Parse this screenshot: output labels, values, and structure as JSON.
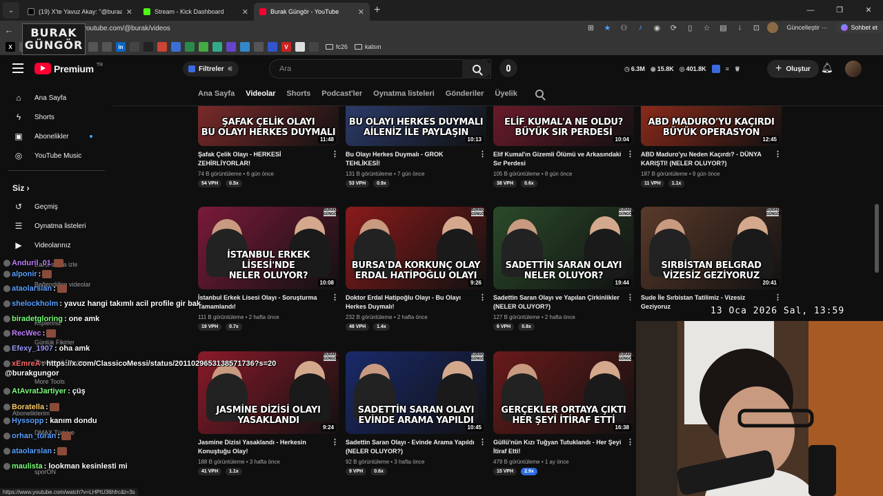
{
  "browser": {
    "tabs": [
      {
        "title": "(19) X'te Yavuz Akay: \"@buraakgu",
        "close": "✕",
        "fav": "#000000",
        "fav_border": "#888888"
      },
      {
        "title": "Stream - Kick Dashboard",
        "close": "✕",
        "fav": "#53fc18",
        "fav_border": "#53fc18"
      },
      {
        "title": "Burak Güngör - YouTube",
        "close": "✕",
        "fav": "#ff0033",
        "fav_border": "#ff0033"
      }
    ],
    "url": "youtube.com/@burak/videos",
    "update_label": "Güncelleştir",
    "chat_label": "Sohbet et",
    "folders": [
      "fc26",
      "kalsın"
    ],
    "status_url": "https://www.youtube.com/watch?v=LHPtU36hfrc&t=3s",
    "overlay_logo": [
      "BURAK",
      "GÜNGÖR"
    ]
  },
  "masthead": {
    "brand": "Premium",
    "region": "TR",
    "filters_label": "Filtreler",
    "search_placeholder": "Ara",
    "stats": [
      "6.3M",
      "15.8K",
      "401.8K"
    ],
    "create_label": "Oluştur"
  },
  "sidebar": {
    "top": [
      {
        "label": "Ana Sayfa",
        "icon": "home-icon"
      },
      {
        "label": "Shorts",
        "icon": "shorts-icon"
      },
      {
        "label": "Abonelikler",
        "icon": "subscriptions-icon"
      },
      {
        "label": "YouTube Music",
        "icon": "music-icon"
      }
    ],
    "you_heading": "Siz",
    "you": [
      {
        "label": "Geçmiş",
        "icon": "history-icon"
      },
      {
        "label": "Oynatma listeleri",
        "icon": "playlists-icon"
      },
      {
        "label": "Videolarınız",
        "icon": "your-videos-icon"
      }
    ],
    "ghost_items": [
      "Daha sonra izle",
      "Beğendiğim videolar",
      "Klipleriniz",
      "Günlük Fikirler",
      "Thumbnail Preview",
      "More Tools",
      "Aboneliklerim",
      "DMAX Türkiye",
      "sporON"
    ]
  },
  "channel_tabs": [
    "Ana Sayfa",
    "Videolar",
    "Shorts",
    "Podcast'ler",
    "Oynatma listeleri",
    "Gönderiler",
    "Üyelik"
  ],
  "videos": [
    {
      "caption": "ŞAFAK ÇELİK OLAYI\nBU OLAYI HERKES DUYMALI",
      "duration": "11:48",
      "title": "Şafak Çelik Olayı - HERKESİ ZEHİRLİYORLAR!",
      "meta": "74 B görüntüleme • 6 gün önce",
      "vph": "54 VPH",
      "ratio": "0.5x",
      "bg": "#7a2a2a"
    },
    {
      "caption": "BU OLAYI HERKES DUYMALI\nAİLENİZ İLE PAYLAŞIN",
      "duration": "10:13",
      "title": "Bu Olayı Herkes Duymalı - GROK TEHLİKESİ!",
      "meta": "131 B görüntüleme • 7 gün önce",
      "vph": "53 VPH",
      "ratio": "0.9x",
      "bg": "#2b3b6a"
    },
    {
      "caption": "ELİF KUMAL'A NE OLDU?\nBÜYÜK SIR PERDESİ",
      "duration": "10:04",
      "title": "Elif Kumal'ın Gizemli Ölümü ve Arkasındaki Sır Perdesi",
      "meta": "105 B görüntüleme • 8 gün önce",
      "vph": "38 VPH",
      "ratio": "0.6x",
      "bg": "#6a1a2a"
    },
    {
      "caption": "ABD MADURO'YU KAÇIRDI\nBÜYÜK OPERASYON",
      "duration": "12:45",
      "title": "ABD Maduro'yu Neden Kaçırdı? - DÜNYA KARIŞTI! (NELER OLUYOR?)",
      "meta": "187 B görüntüleme • 9 gün önce",
      "vph": "11 VPH",
      "ratio": "1.1x",
      "bg": "#8a2a1a"
    },
    {
      "caption": "İSTANBUL ERKEK LİSESİ'NDE\nNELER OLUYOR?",
      "duration": "10:08",
      "title": "İstanbul Erkek Lisesi Olayı - Soruşturma Tamamlandı!",
      "meta": "111 B görüntüleme • 2 hafta önce",
      "vph": "19 VPH",
      "ratio": "0.7x",
      "bg": "#7a1a3a"
    },
    {
      "caption": "BURSA'DA KORKUNÇ OLAY\nERDAL HATİPOĞLU OLAYI",
      "duration": "9:26",
      "title": "Doktor Erdal Hatipoğlu Olayı - Bu Olayı Herkes Duymalı!",
      "meta": "232 B görüntüleme • 2 hafta önce",
      "vph": "48 VPH",
      "ratio": "1.4x",
      "bg": "#8a1a1a"
    },
    {
      "caption": "SADETTİN SARAN OLAYI\nNELER OLUYOR?",
      "duration": "19:44",
      "title": "Sadettin Saran Olayı ve Yapılan Çirkinlikler (NELER OLUYOR?)",
      "meta": "127 B görüntüleme • 2 hafta önce",
      "vph": "6 VPH",
      "ratio": "0.8x",
      "bg": "#2a4a2a"
    },
    {
      "caption": "SIRBİSTAN BELGRAD\nVİZESİZ GEZİYORUZ",
      "duration": "20:41",
      "title": "Sude İle Sırbistan Tatilimiz - Vizesiz Geziyoruz",
      "meta": "",
      "vph": "",
      "ratio": "",
      "bg": "#5a3a2a"
    },
    {
      "caption": "JASMİNE DİZİSİ OLAYI\nYASAKLANDI",
      "duration": "9:24",
      "title": "Jasmine Dizisi Yasaklandı - Herkesin Konuştuğu Olay!",
      "meta": "188 B görüntüleme • 3 hafta önce",
      "vph": "41 VPH",
      "ratio": "1.1x",
      "bg": "#8a1a2a"
    },
    {
      "caption": "SADETTİN SARAN OLAYI\nEVİNDE ARAMA YAPILDI",
      "duration": "10:45",
      "title": "Sadettin Saran Olayı - Evinde Arama Yapıldı (NELER OLUYOR?)",
      "meta": "92 B görüntüleme • 3 hafta önce",
      "vph": "9 VPH",
      "ratio": "0.6x",
      "bg": "#1a2a6a"
    },
    {
      "caption": "GERÇEKLER ORTAYA ÇIKTI\nHER ŞEYİ İTİRAF ETTİ",
      "duration": "16:38",
      "title": "Güllü'nün Kızı Tuğyan Tutuklandı - Her Şeyi İtiraf Etti!",
      "meta": "479 B görüntüleme • 1 ay önce",
      "vph": "15 VPH",
      "ratio": "2.9x",
      "bg": "#6a1a1a",
      "ratio_blue": true
    }
  ],
  "chat": [
    {
      "user": "Anduril_01",
      "text": "",
      "color": "#c080ff"
    },
    {
      "user": "alponir",
      "text": ":",
      "color": "#5aa0ff"
    },
    {
      "user": "ataolarslan",
      "text": ":",
      "color": "#5aa0ff"
    },
    {
      "user": "shelockholm",
      "text": ": yavuz hangi takımlı acil profile gir bak",
      "color": "#5aa0ff"
    },
    {
      "user": "biradetgloring",
      "text": ": one amk",
      "color": "#7cff7c"
    },
    {
      "user": "RecWec",
      "text": ":",
      "color": "#c080ff"
    },
    {
      "user": "Efexy_1907",
      "text": ": oha amk",
      "color": "#9a9aff"
    },
    {
      "user": "xEmreA",
      "text": ": https://x.com/ClassicoMessi/status/2011029653138571736?s=20",
      "color": "#ff6a6a"
    },
    {
      "user": "",
      "text": "@burakgungor",
      "color": "#ffffff"
    },
    {
      "user": "AtAvratJartiyer",
      "text": ": çüş",
      "color": "#7cff7c"
    },
    {
      "user": "Boratella",
      "text": ":",
      "color": "#ffcc66"
    },
    {
      "user": "Hyssopp",
      "text": ": kanım dondu",
      "color": "#5aa0ff"
    },
    {
      "user": "orhan_turan",
      "text": ":",
      "color": "#5aa0ff"
    },
    {
      "user": "ataolarslan",
      "text": ":",
      "color": "#5aa0ff"
    },
    {
      "user": "maulista",
      "text": ": lookman kesinlesti mi",
      "color": "#7cff7c"
    }
  ],
  "clock": "13 Oca 2026 Sal, 13:59"
}
